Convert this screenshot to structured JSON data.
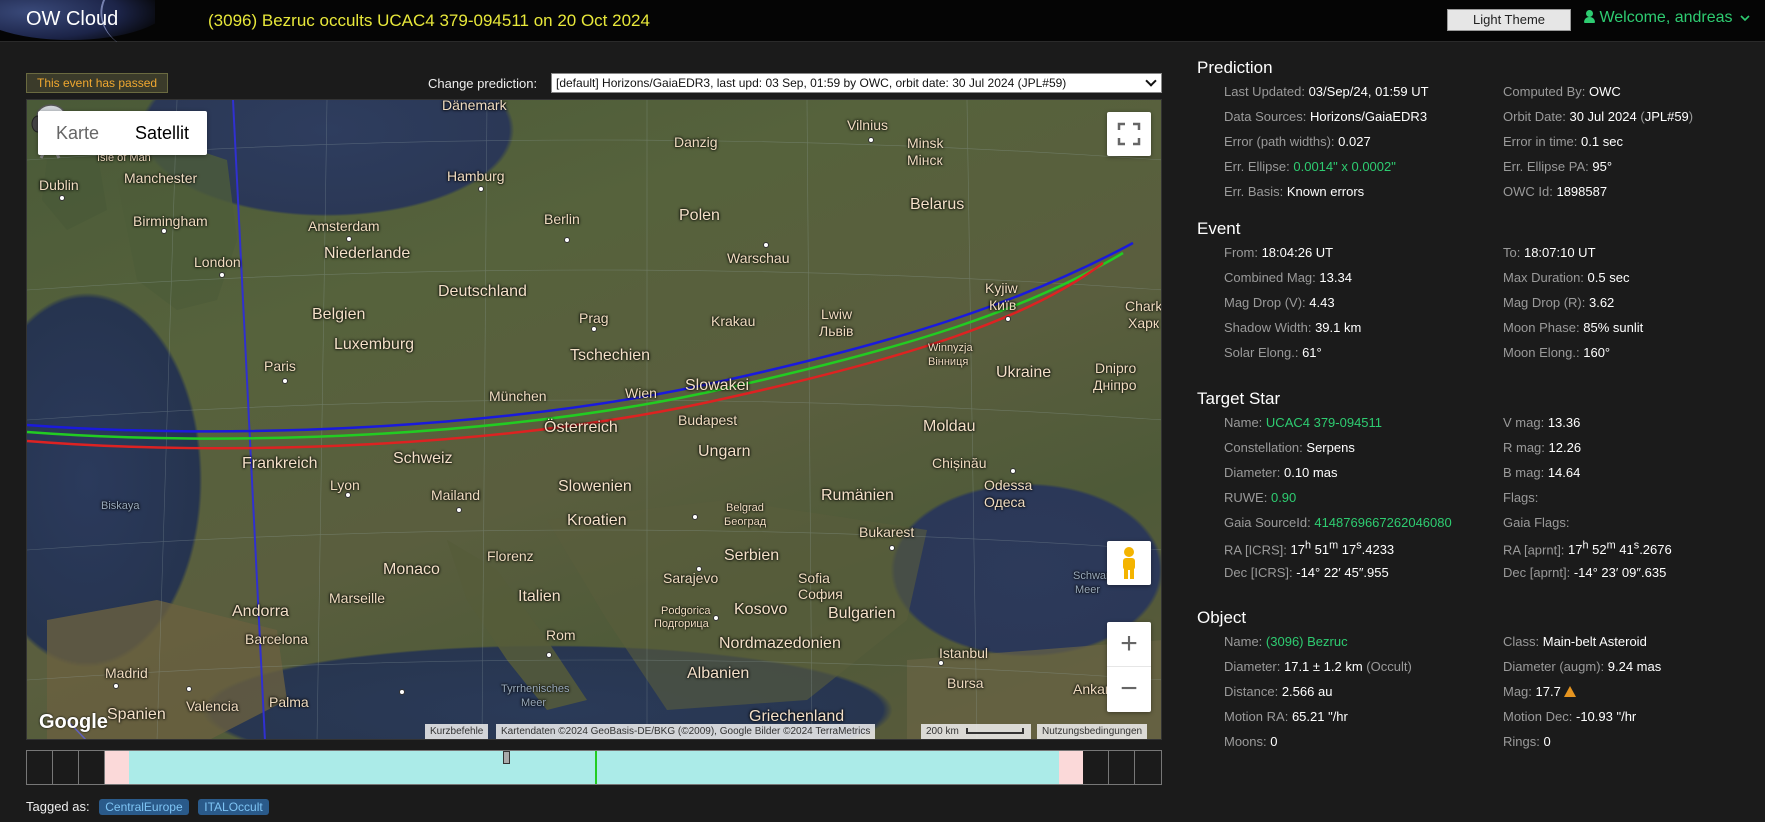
{
  "header": {
    "logo": "OW Cloud",
    "title": "(3096) Bezruc occults UCAC4 379-094511 on 20 Oct 2024",
    "theme_button": "Light Theme",
    "welcome": "Welcome, andreas"
  },
  "event_status": "This event has passed",
  "change_prediction": {
    "label": "Change prediction:",
    "selected": "[default] Horizons/GaiaEDR3, last upd: 03 Sep, 01:59 by OWC, orbit date: 30 Jul 2024 (JPL#59)"
  },
  "map": {
    "type_karte": "Karte",
    "type_satellit": "Satellit",
    "google": "Google",
    "attribution": {
      "shortcuts": "Kurzbefehle",
      "data": "Kartendaten ©2024 GeoBasis-DE/BKG (©2009), Google Bilder ©2024 TerraMetrics",
      "scale": "200 km",
      "terms": "Nutzungsbedingungen"
    },
    "labels": {
      "danemark": "Dänemark",
      "dublin": "Dublin",
      "isle_of_man": "Isle of Man",
      "manchester": "Manchester",
      "birmingham": "Birmingham",
      "london": "London",
      "amsterdam": "Amsterdam",
      "niederlande": "Niederlande",
      "hamburg": "Hamburg",
      "berlin": "Berlin",
      "deutschland": "Deutschland",
      "belgien": "Belgien",
      "luxemburg": "Luxemburg",
      "paris": "Paris",
      "frankreich": "Frankreich",
      "lyon": "Lyon",
      "schweiz": "Schweiz",
      "mailand": "Mailand",
      "muenchen": "München",
      "prag": "Prag",
      "tschechien": "Tschechien",
      "osterreich": "Österreich",
      "wien": "Wien",
      "slowakei": "Slowakei",
      "budapest": "Budapest",
      "ungarn": "Ungarn",
      "slowenien": "Slowenien",
      "kroatien": "Kroatien",
      "danzig": "Danzig",
      "polen": "Polen",
      "warschau": "Warschau",
      "krakau": "Krakau",
      "vilnius": "Vilnius",
      "minsk": "Minsk",
      "minsk_cyr": "Мінск",
      "belarus": "Belarus",
      "lwiw": "Lwiw",
      "lwiw_cyr": "Львів",
      "kyjiw": "Kyjiw",
      "kyjiw_cyr": "Київ",
      "winnyzja": "Winnyzja",
      "winnyzja_cyr": "Вінниця",
      "ukraine": "Ukraine",
      "dnipro": "Dnipro",
      "dnipro_cyr": "Дніпро",
      "chark": "Chark",
      "chark_cyr": "Харк",
      "moldau": "Moldau",
      "chisinau": "Chișinău",
      "odessa": "Odessa",
      "odessa_cyr": "Одеса",
      "rumaenien": "Rumänien",
      "bukarest": "Bukarest",
      "belgrad": "Belgrad",
      "belgrad_cyr": "Београд",
      "serbien": "Serbien",
      "sarajevo": "Sarajevo",
      "sofia": "Sofia",
      "sofia_cyr": "София",
      "bulgarien": "Bulgarien",
      "podgorica": "Podgorica",
      "podgorica_cyr": "Подгорица",
      "kosovo": "Kosovo",
      "nordmazedonien": "Nordmazedonien",
      "albanien": "Albanien",
      "griechenland": "Griechenland",
      "istanbul": "Istanbul",
      "bursa": "Bursa",
      "ankara": "Ankara",
      "florenz": "Florenz",
      "monaco": "Monaco",
      "italien": "Italien",
      "rom": "Rom",
      "marseille": "Marseille",
      "andorra": "Andorra",
      "barcelona": "Barcelona",
      "madrid": "Madrid",
      "spanien": "Spanien",
      "valencia": "Valencia",
      "palma": "Palma",
      "biskaya": "Biskaya",
      "tyrrhenisches": "Tyrrhenisches",
      "meer": "Meer",
      "schwarzes": "Schwarz",
      "meer2": "Meer"
    }
  },
  "tags": {
    "label": "Tagged as:",
    "items": [
      "CentralEurope",
      "ITALOccult"
    ]
  },
  "prediction": {
    "heading": "Prediction",
    "last_updated_k": "Last Updated:",
    "last_updated_v": "03/Sep/24, 01:59 UT",
    "computed_by_k": "Computed By:",
    "computed_by_v": "OWC",
    "data_sources_k": "Data Sources:",
    "data_sources_v": "Horizons/GaiaEDR3",
    "orbit_date_k": "Orbit Date:",
    "orbit_date_v": "30 Jul 2024",
    "orbit_date_jpl": "JPL#59",
    "error_path_k": "Error (path widths):",
    "error_path_v": "0.027",
    "error_time_k": "Error in time:",
    "error_time_v": "0.1 sec",
    "err_ellipse_k": "Err. Ellipse:",
    "err_ellipse_v": "0.0014\" x 0.0002\"",
    "err_ellipse_pa_k": "Err. Ellipse PA:",
    "err_ellipse_pa_v": "95°",
    "err_basis_k": "Err. Basis:",
    "err_basis_v": "Known errors",
    "owc_id_k": "OWC Id:",
    "owc_id_v": "1898587"
  },
  "event": {
    "heading": "Event",
    "from_k": "From:",
    "from_v": "18:04:26 UT",
    "to_k": "To:",
    "to_v": "18:07:10 UT",
    "comb_mag_k": "Combined Mag:",
    "comb_mag_v": "13.34",
    "max_dur_k": "Max Duration:",
    "max_dur_v": "0.5 sec",
    "mag_drop_v_k": "Mag Drop (V):",
    "mag_drop_v_v": "4.43",
    "mag_drop_r_k": "Mag Drop (R):",
    "mag_drop_r_v": "3.62",
    "shadow_k": "Shadow Width:",
    "shadow_v": "39.1 km",
    "moon_phase_k": "Moon Phase:",
    "moon_phase_v": "85% sunlit",
    "solar_k": "Solar Elong.:",
    "solar_v": "61°",
    "moon_elong_k": "Moon Elong.:",
    "moon_elong_v": "160°"
  },
  "target_star": {
    "heading": "Target Star",
    "name_k": "Name:",
    "name_v": "UCAC4 379-094511",
    "vmag_k": "V mag:",
    "vmag_v": "13.36",
    "const_k": "Constellation:",
    "const_v": "Serpens",
    "rmag_k": "R mag:",
    "rmag_v": "12.26",
    "diam_k": "Diameter:",
    "diam_v": "0.10 mas",
    "bmag_k": "B mag:",
    "bmag_v": "14.64",
    "ruwe_k": "RUWE:",
    "ruwe_v": "0.90",
    "flags_k": "Flags:",
    "gaia_id_k": "Gaia SourceId:",
    "gaia_id_v": "4148769667262046080",
    "gaia_flags_k": "Gaia Flags:",
    "ra_icrs_k": "RA [ICRS]:",
    "ra_icrs_h": "17",
    "ra_icrs_m": "51",
    "ra_icrs_s": "17",
    "ra_icrs_f": ".4233",
    "ra_aprnt_k": "RA [aprnt]:",
    "ra_aprnt_h": "17",
    "ra_aprnt_m": "52",
    "ra_aprnt_s": "41",
    "ra_aprnt_f": ".2676",
    "dec_icrs_k": "Dec [ICRS]:",
    "dec_icrs_v": "-14° 22′ 45″.955",
    "dec_aprnt_k": "Dec [aprnt]:",
    "dec_aprnt_v": "-14° 23′ 09″.635"
  },
  "object": {
    "heading": "Object",
    "name_k": "Name:",
    "name_v": "(3096) Bezruc",
    "class_k": "Class:",
    "class_v": "Main-belt Asteroid",
    "diam_k": "Diameter:",
    "diam_v": "17.1 ± 1.2 km",
    "diam_src": "(Occult)",
    "diam_augm_k": "Diameter (augm):",
    "diam_augm_v": "9.24 mas",
    "dist_k": "Distance:",
    "dist_v": "2.566 au",
    "mag_k": "Mag:",
    "mag_v": "17.7",
    "mra_k": "Motion RA:",
    "mra_v": "65.21 \"/hr",
    "mdec_k": "Motion Dec:",
    "mdec_v": "-10.93 \"/hr",
    "moons_k": "Moons:",
    "moons_v": "0",
    "rings_k": "Rings:",
    "rings_v": "0"
  },
  "colors": {
    "accent_green": "#2ecc71",
    "title_yellow": "#e8e83a",
    "passed_orange": "#f0a830",
    "path_blue": "#1a1adc",
    "path_green": "#22cc22",
    "path_red": "#dd2222"
  },
  "icons": {
    "user": "user-icon",
    "chevron": "chevron-down-icon",
    "fullscreen": "fullscreen-icon",
    "pegman": "pegman-icon",
    "telescope": "telescope-icon",
    "warning": "warning-icon"
  }
}
